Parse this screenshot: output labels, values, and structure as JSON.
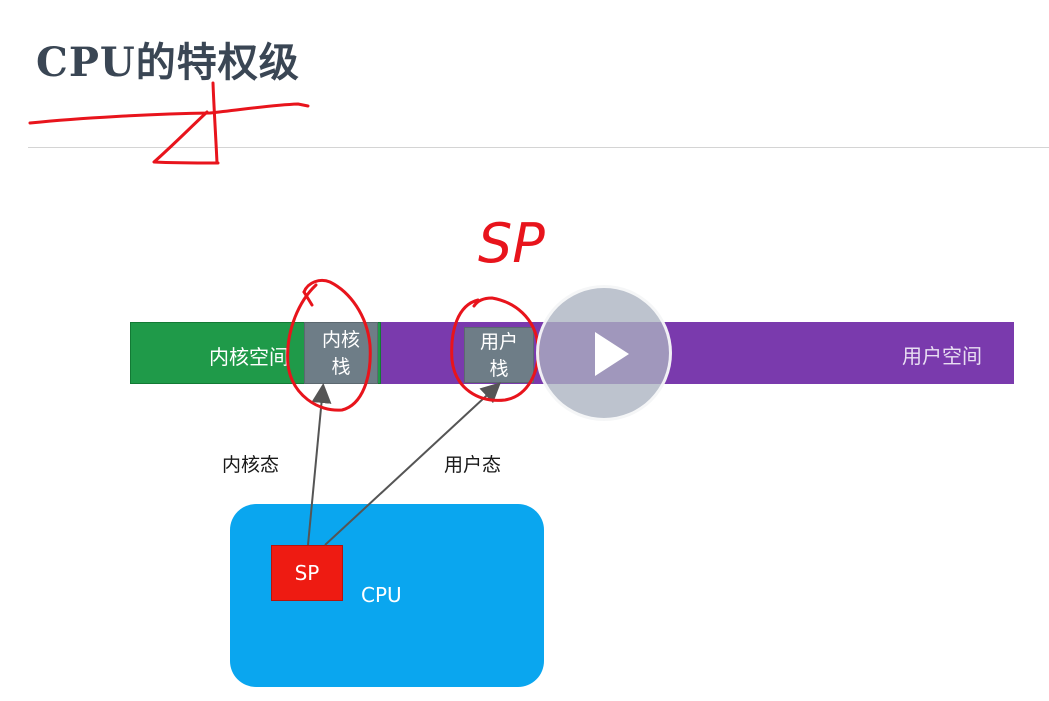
{
  "slide": {
    "title": "CPU的特权级"
  },
  "memory": {
    "kernel_space_label": "内核空间",
    "user_space_label": "用户空间",
    "kernel_stack_line1": "内核",
    "kernel_stack_line2": "栈",
    "user_stack_line1": "用户",
    "user_stack_line2": "栈"
  },
  "modes": {
    "kernel_mode_label": "内核态",
    "user_mode_label": "用户态"
  },
  "cpu": {
    "label": "CPU",
    "register_label": "SP"
  },
  "annotation": {
    "handwritten_text": "SP"
  },
  "colors": {
    "kernel_space": "#1f9a49",
    "user_space": "#7a3aad",
    "stack": "#6e7d87",
    "cpu": "#0aa6ef",
    "sp_register": "#ee1b12",
    "ink": "#e8141c"
  },
  "video": {
    "play_icon": "play-icon"
  }
}
